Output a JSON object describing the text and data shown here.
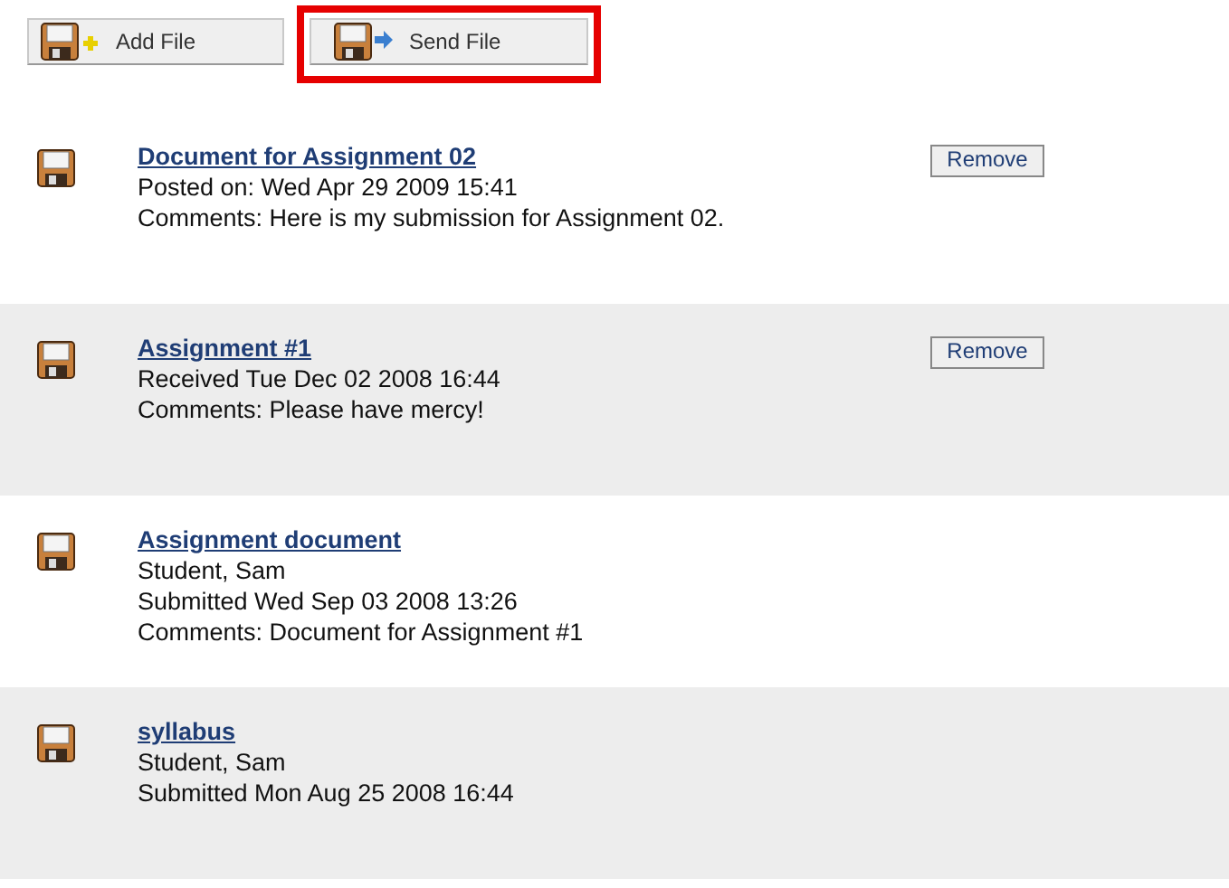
{
  "toolbar": [
    {
      "kind": "add",
      "label": "Add File",
      "highlighted": false
    },
    {
      "kind": "send",
      "label": "Send File",
      "highlighted": true
    }
  ],
  "files": [
    {
      "title": "Document for Assignment 02",
      "lines": [
        "Posted on: Wed Apr 29 2009 15:41",
        "Comments: Here is my submission for Assignment 02."
      ],
      "remove": "Remove"
    },
    {
      "title": "Assignment #1",
      "lines": [
        "Received Tue Dec 02 2008 16:44",
        "Comments: Please have mercy!"
      ],
      "remove": "Remove"
    },
    {
      "title": "Assignment document",
      "lines": [
        "Student, Sam",
        "Submitted Wed Sep 03 2008 13:26",
        "Comments: Document for Assignment #1"
      ]
    },
    {
      "title": "syllabus",
      "lines": [
        "Student, Sam",
        "Submitted Mon Aug 25 2008 16:44"
      ]
    }
  ]
}
